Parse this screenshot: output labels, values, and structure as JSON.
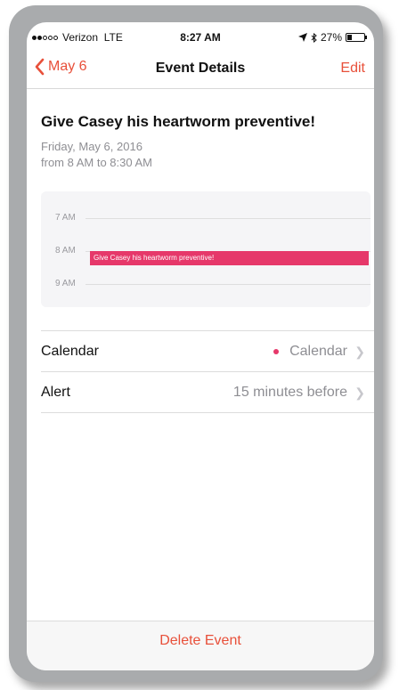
{
  "status_bar": {
    "carrier": "Verizon",
    "network": "LTE",
    "time": "8:27 AM",
    "battery": "27%",
    "battery_level": 0.27,
    "signal_bars_filled": 2,
    "signal_bars_total": 5
  },
  "nav": {
    "back_label": "May 6",
    "title": "Event Details",
    "edit_label": "Edit"
  },
  "event": {
    "title": "Give Casey his heartworm preventive!",
    "date": "Friday, May 6, 2016",
    "time_range": "from 8 AM to 8:30 AM"
  },
  "day_preview": {
    "hours": [
      "7 AM",
      "8 AM",
      "9 AM"
    ],
    "event_label": "Give Casey his heartworm preventive!"
  },
  "details": {
    "calendar_label": "Calendar",
    "calendar_value": "Calendar",
    "alert_label": "Alert",
    "alert_value": "15 minutes before"
  },
  "footer": {
    "delete_label": "Delete Event"
  },
  "colors": {
    "accent": "#e8503a",
    "event_pink": "#e6386a",
    "secondary_text": "#8e8e93"
  }
}
